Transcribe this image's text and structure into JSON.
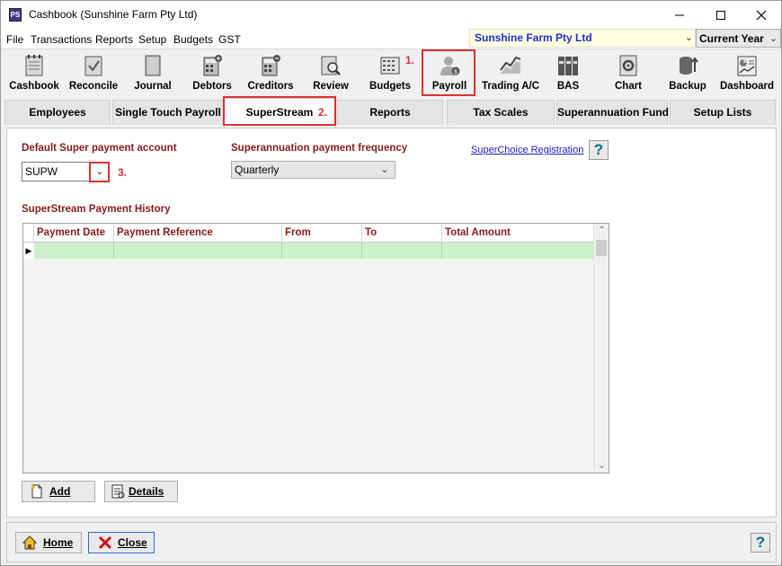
{
  "window": {
    "title": "Cashbook (Sunshine Farm Pty Ltd)",
    "app_icon_text": "PS"
  },
  "menu": {
    "items": [
      "File",
      "Transactions",
      "Reports",
      "Setup",
      "Budgets",
      "GST"
    ]
  },
  "company": {
    "name": "Sunshine Farm Pty Ltd"
  },
  "year_select": {
    "value": "Current Year"
  },
  "toolbar": {
    "items": [
      {
        "label": "Cashbook",
        "icon": "notepad-icon"
      },
      {
        "label": "Reconcile",
        "icon": "checklist-icon"
      },
      {
        "label": "Journal",
        "icon": "book-icon"
      },
      {
        "label": "Debtors",
        "icon": "calculator-plus-icon"
      },
      {
        "label": "Creditors",
        "icon": "calculator-minus-icon"
      },
      {
        "label": "Review",
        "icon": "magnifier-icon"
      },
      {
        "label": "Budgets",
        "icon": "grid-icon"
      },
      {
        "label": "Payroll",
        "icon": "person-dollar-icon"
      },
      {
        "label": "Trading A/C",
        "icon": "line-chart-icon"
      },
      {
        "label": "BAS",
        "icon": "binders-icon"
      },
      {
        "label": "Chart",
        "icon": "gear-document-icon"
      },
      {
        "label": "Backup",
        "icon": "database-arrow-icon"
      },
      {
        "label": "Dashboard",
        "icon": "dashboard-icon"
      }
    ]
  },
  "steps": {
    "one": "1.",
    "two": "2.",
    "three": "3."
  },
  "tabs": [
    "Employees",
    "Single Touch Payroll",
    "SuperStream",
    "Reports",
    "Tax Scales",
    "Superannuation Fund",
    "Setup Lists"
  ],
  "active_tab": "SuperStream",
  "form": {
    "default_super_label": "Default Super payment account",
    "default_super_value": "SUPW",
    "frequency_label": "Superannuation payment frequency",
    "frequency_value": "Quarterly",
    "superchoice_link": "SuperChoice Registration",
    "help_glyph": "?"
  },
  "history": {
    "title": "SuperStream Payment History",
    "columns": [
      "Payment Date",
      "Payment Reference",
      "From",
      "To",
      "Total Amount"
    ]
  },
  "buttons": {
    "add": "Add",
    "details": "Details",
    "home": "Home",
    "close": "Close"
  },
  "colors": {
    "label_red": "#8b1a1a",
    "highlight_red": "#e03030",
    "row_green": "#ccf0cc",
    "company_blue": "#1c2fcf"
  }
}
